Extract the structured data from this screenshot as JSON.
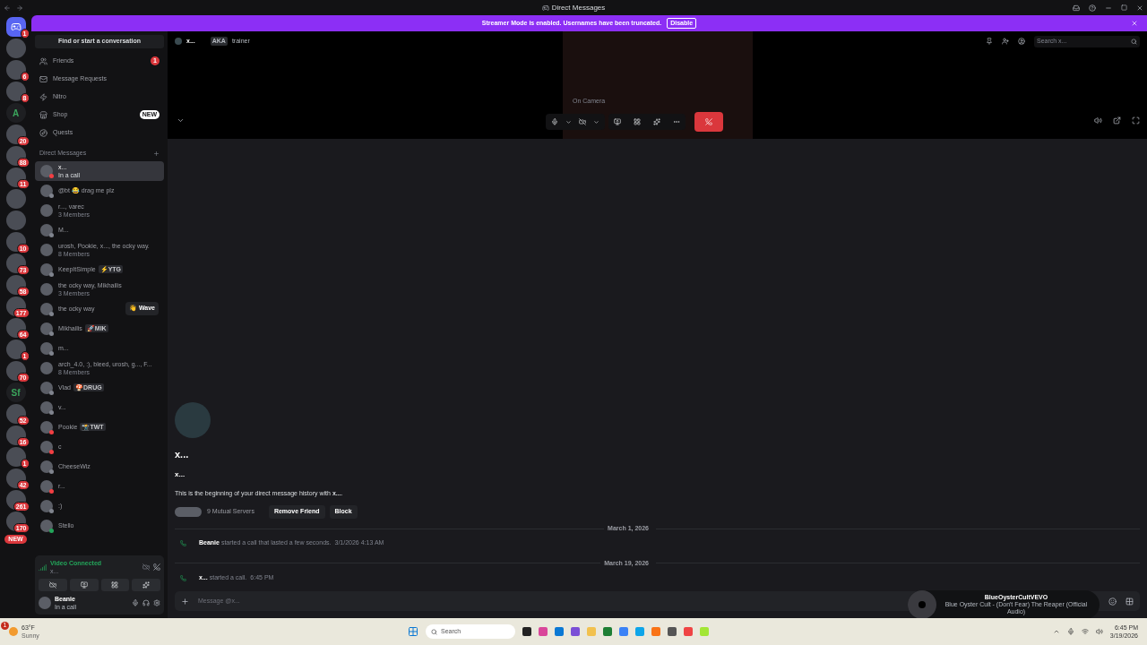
{
  "titlebar": {
    "title": "Direct Messages"
  },
  "banner": {
    "text": "Streamer Mode is enabled. Usernames have been truncated.",
    "button": "Disable"
  },
  "servers": [
    {
      "kind": "home",
      "badge": "1"
    },
    {
      "kind": "avatar"
    },
    {
      "kind": "avatar",
      "badge": "6"
    },
    {
      "kind": "avatar",
      "badge": "8"
    },
    {
      "kind": "letter",
      "label": "A"
    },
    {
      "kind": "avatar",
      "badge": "20"
    },
    {
      "kind": "avatar",
      "badge": "88"
    },
    {
      "kind": "avatar",
      "badge": "11"
    },
    {
      "kind": "avatar"
    },
    {
      "kind": "avatar"
    },
    {
      "kind": "avatar",
      "badge": "10"
    },
    {
      "kind": "avatar",
      "badge": "73"
    },
    {
      "kind": "avatar",
      "badge": "58"
    },
    {
      "kind": "avatar",
      "badge": "177"
    },
    {
      "kind": "avatar",
      "badge": "64"
    },
    {
      "kind": "avatar",
      "badge": "1"
    },
    {
      "kind": "avatar",
      "badge": "70"
    },
    {
      "kind": "letter",
      "label": "Sf"
    },
    {
      "kind": "avatar",
      "badge": "52"
    },
    {
      "kind": "avatar",
      "badge": "16"
    },
    {
      "kind": "avatar",
      "badge": "1"
    },
    {
      "kind": "avatar",
      "badge": "42"
    },
    {
      "kind": "avatar",
      "badge": "261"
    },
    {
      "kind": "avatar",
      "badge": "170"
    },
    {
      "kind": "pill",
      "label": "NEW"
    }
  ],
  "sidebar": {
    "search": "Find or start a conversation",
    "nav": [
      {
        "kind": "friends",
        "label": "Friends",
        "badge": "1"
      },
      {
        "kind": "requests",
        "label": "Message Requests"
      },
      {
        "kind": "nitro",
        "label": "Nitro"
      },
      {
        "kind": "shop",
        "label": "Shop",
        "tag": "NEW"
      },
      {
        "kind": "quests",
        "label": "Quests"
      }
    ],
    "dm_header": "Direct Messages",
    "dms": [
      {
        "name": "x...",
        "subtitle": "In a call",
        "color": "#f23f43",
        "selected": true
      },
      {
        "name": "@bt 😂 drag me plz",
        "color": "#80848e",
        "selected": false
      },
      {
        "name": "r..., varec",
        "subtitle": "3 Members",
        "selected": false
      },
      {
        "name": "M...",
        "color": "#80848e",
        "selected": false
      },
      {
        "name": "urosh, Pookie, x..., the ocky way.",
        "subtitle": "8 Members",
        "selected": false
      },
      {
        "name": "KeepItSimple",
        "tag": "⚡YTG",
        "color": "#80848e",
        "selected": false
      },
      {
        "name": "the ocky way, Mikhailis",
        "subtitle": "3 Members",
        "selected": false
      },
      {
        "name": "the ocky way",
        "action": "👋 Wave",
        "color": "#80848e",
        "selected": false
      },
      {
        "name": "Mikhailis",
        "tag": "🚀MIK",
        "color": "#80848e",
        "selected": false
      },
      {
        "name": "m...",
        "color": "#80848e",
        "selected": false
      },
      {
        "name": "arch_4.0, :), bleed, urosh, g..., F...",
        "subtitle": "8 Members",
        "selected": false
      },
      {
        "name": "Vlad",
        "tag": "🍄DRUG",
        "color": "#80848e",
        "selected": false
      },
      {
        "name": "v...",
        "color": "#80848e",
        "selected": false
      },
      {
        "name": "Pookie",
        "tag": "📸TWT",
        "color": "#f23f43",
        "selected": false
      },
      {
        "name": "c",
        "color": "#f23f43",
        "selected": false
      },
      {
        "name": "CheeseWiz",
        "color": "#80848e",
        "selected": false
      },
      {
        "name": "r...",
        "color": "#f23f43",
        "selected": false
      },
      {
        "name": ":)",
        "color": "#80848e",
        "selected": false
      },
      {
        "name": "Stello",
        "color": "#23a55a",
        "selected": false
      }
    ],
    "voice": {
      "title": "Video Connected",
      "subtitle": "x..."
    },
    "user": {
      "name": "Beanie",
      "status": "In a call"
    }
  },
  "call": {
    "name": "x...",
    "aka": "AKA",
    "nickname": "trainer",
    "search_placeholder": "Search x...",
    "tooltip": "On Camera"
  },
  "chat": {
    "title": "x...",
    "username": "x...",
    "intro": "This is the beginning of your direct message history with **x...**.",
    "mutual": "9 Mutual Servers",
    "buttons": [
      "Remove Friend",
      "Block"
    ],
    "events": [
      {
        "date": "March 1, 2026",
        "author": "Beanie",
        "text": "started a call that lasted a few seconds.",
        "time": "3/1/2026 4:13 AM"
      },
      {
        "date": "March 19, 2026",
        "author": "x...",
        "text": "started a call.",
        "time": "6:45 PM"
      }
    ],
    "input_placeholder": "Message @x..."
  },
  "now_playing": {
    "channel": "BlueOysterCultVEVO",
    "title": "Blue Oyster Cult - (Don't Fear) The Reaper (Official Audio)"
  },
  "taskbar": {
    "temperature": "63°F",
    "weather": "Sunny",
    "weather_badge": "1",
    "search": "Search",
    "time": "6:45 PM",
    "date": "3/19/2026"
  }
}
